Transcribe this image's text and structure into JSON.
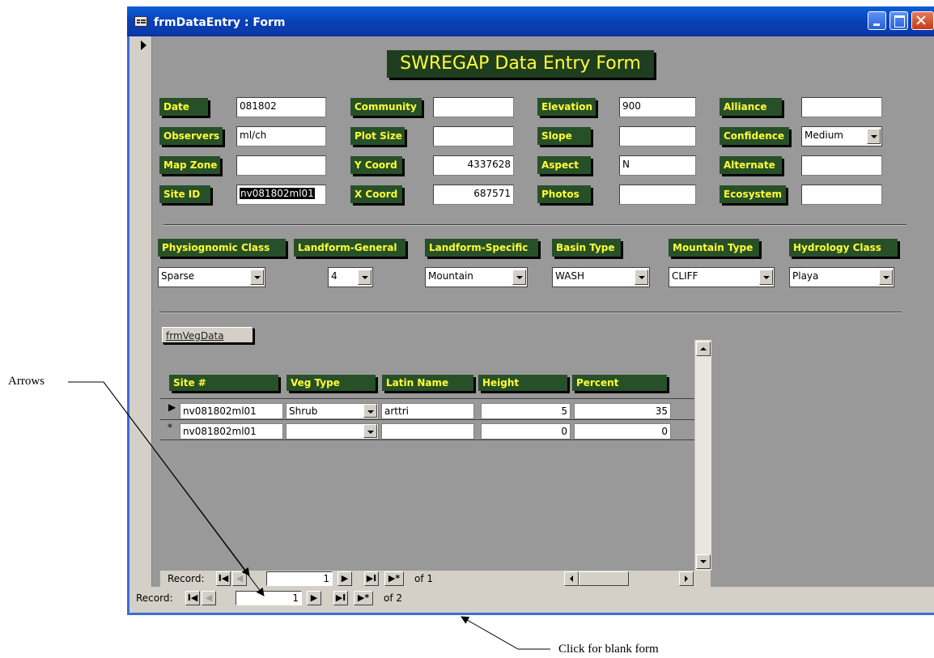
{
  "window": {
    "title": "frmDataEntry : Form"
  },
  "form": {
    "heading": "SWREGAP Data Entry Form",
    "fields": {
      "date": {
        "label": "Date",
        "value": "081802"
      },
      "observers": {
        "label": "Observers",
        "value": "ml/ch"
      },
      "map_zone": {
        "label": "Map Zone",
        "value": ""
      },
      "site_id": {
        "label": "Site ID",
        "value": "nv081802ml01"
      },
      "community": {
        "label": "Community",
        "value": ""
      },
      "plot_size": {
        "label": "Plot Size",
        "value": ""
      },
      "y_coord": {
        "label": "Y Coord",
        "value": "4337628"
      },
      "x_coord": {
        "label": "X Coord",
        "value": "687571"
      },
      "elevation": {
        "label": "Elevation",
        "value": "900"
      },
      "slope": {
        "label": "Slope",
        "value": ""
      },
      "aspect": {
        "label": "Aspect",
        "value": "N"
      },
      "photos": {
        "label": "Photos",
        "value": ""
      },
      "alliance": {
        "label": "Alliance",
        "value": ""
      },
      "confidence": {
        "label": "Confidence",
        "value": "Medium"
      },
      "alternate": {
        "label": "Alternate",
        "value": ""
      },
      "ecosystem": {
        "label": "Ecosystem",
        "value": ""
      }
    },
    "classes": {
      "physiognomic": {
        "label": "Physiognomic Class",
        "value": "Sparse"
      },
      "landform_general": {
        "label": "Landform-General",
        "value": "4"
      },
      "landform_specific": {
        "label": "Landform-Specific",
        "value": "Mountain"
      },
      "basin_type": {
        "label": "Basin Type",
        "value": "WASH"
      },
      "mountain_type": {
        "label": "Mountain Type",
        "value": "CLIFF"
      },
      "hydrology": {
        "label": "Hydrology Class",
        "value": "Playa"
      }
    }
  },
  "subform": {
    "label": "frmVegData",
    "columns": [
      "Site #",
      "Veg Type",
      "Latin Name",
      "Height",
      "Percent"
    ],
    "rows": [
      {
        "marker": "▶",
        "site": "nv081802ml01",
        "veg_type": "Shrub",
        "latin": "arttri",
        "height": "5",
        "percent": "35"
      },
      {
        "marker": "*",
        "site": "nv081802ml01",
        "veg_type": "",
        "latin": "",
        "height": "0",
        "percent": "0"
      }
    ],
    "nav": {
      "label": "Record:",
      "current": "1",
      "total": "of 1"
    }
  },
  "main_nav": {
    "label": "Record:",
    "current": "1",
    "total": "of 2"
  },
  "annotations": {
    "arrows": "Arrows",
    "blank_form": "Click for blank form"
  }
}
